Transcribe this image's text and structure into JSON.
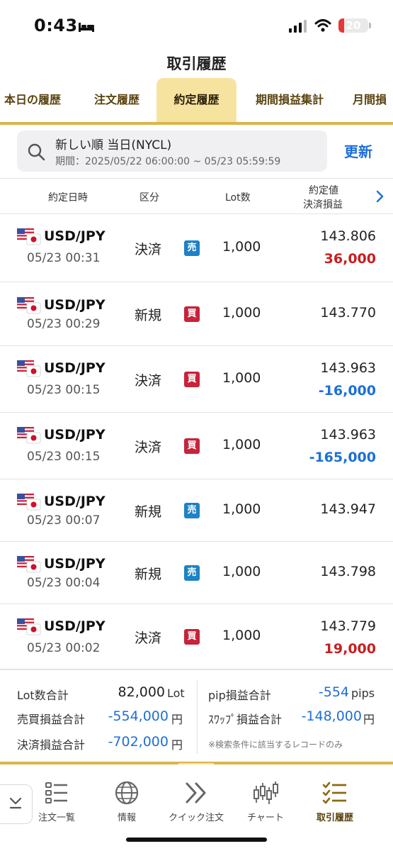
{
  "status_bar": {
    "time": "0:43",
    "battery": "20",
    "battery_level": 0.2
  },
  "header": {
    "title": "取引履歴"
  },
  "tabs": [
    {
      "label": "本日の履歴",
      "active": false
    },
    {
      "label": "注文履歴",
      "active": false
    },
    {
      "label": "約定履歴",
      "active": true
    },
    {
      "label": "期間損益集計",
      "active": false
    },
    {
      "label": "月間損",
      "active": false
    }
  ],
  "search": {
    "main": "新しい順 当日(NYCL)",
    "period": "期間：2025/05/22 06:00:00 ~ 05/23 05:59:59",
    "refresh_label": "更新"
  },
  "columns": {
    "datetime": "約定日時",
    "kind": "区分",
    "lot": "Lot数",
    "price": "約定値",
    "pnl": "決済損益"
  },
  "side_labels": {
    "sell": "売",
    "buy": "買"
  },
  "rows": [
    {
      "pair": "USD/JPY",
      "datetime": "05/23 00:31",
      "kind": "決済",
      "side": "sell",
      "side_label": "売",
      "lot": "1,000",
      "price": "143.806",
      "pnl": "36,000",
      "pnl_sign": "pos"
    },
    {
      "pair": "USD/JPY",
      "datetime": "05/23 00:29",
      "kind": "新規",
      "side": "buy",
      "side_label": "買",
      "lot": "1,000",
      "price": "143.770",
      "pnl": "",
      "pnl_sign": ""
    },
    {
      "pair": "USD/JPY",
      "datetime": "05/23 00:15",
      "kind": "決済",
      "side": "buy",
      "side_label": "買",
      "lot": "1,000",
      "price": "143.963",
      "pnl": "-16,000",
      "pnl_sign": "neg"
    },
    {
      "pair": "USD/JPY",
      "datetime": "05/23 00:15",
      "kind": "決済",
      "side": "buy",
      "side_label": "買",
      "lot": "1,000",
      "price": "143.963",
      "pnl": "-165,000",
      "pnl_sign": "neg"
    },
    {
      "pair": "USD/JPY",
      "datetime": "05/23 00:07",
      "kind": "新規",
      "side": "sell",
      "side_label": "売",
      "lot": "1,000",
      "price": "143.947",
      "pnl": "",
      "pnl_sign": ""
    },
    {
      "pair": "USD/JPY",
      "datetime": "05/23 00:04",
      "kind": "新規",
      "side": "sell",
      "side_label": "売",
      "lot": "1,000",
      "price": "143.798",
      "pnl": "",
      "pnl_sign": ""
    },
    {
      "pair": "USD/JPY",
      "datetime": "05/23 00:02",
      "kind": "決済",
      "side": "buy",
      "side_label": "買",
      "lot": "1,000",
      "price": "143.779",
      "pnl": "19,000",
      "pnl_sign": "pos"
    }
  ],
  "summary": {
    "lot_total_label": "Lot数合計",
    "lot_total_value": "82,000",
    "lot_total_unit": "Lot",
    "trade_pnl_label": "売買損益合計",
    "trade_pnl_value": "-554,000",
    "trade_pnl_unit": "円",
    "settle_pnl_label": "決済損益合計",
    "settle_pnl_value": "-702,000",
    "settle_pnl_unit": "円",
    "pip_pnl_label": "pip損益合計",
    "pip_pnl_value": "-554",
    "pip_pnl_unit": "pips",
    "swap_pnl_label": "ｽﾜｯﾌﾟ損益合計",
    "swap_pnl_value": "-148,000",
    "swap_pnl_unit": "円",
    "note": "※検索条件に該当するレコードのみ"
  },
  "bottom_nav": [
    {
      "label": "注文一覧",
      "icon": "list-icon",
      "active": false
    },
    {
      "label": "情報",
      "icon": "globe-icon",
      "active": false
    },
    {
      "label": "クイック注文",
      "icon": "double-chevron-icon",
      "active": false
    },
    {
      "label": "チャート",
      "icon": "candlestick-icon",
      "active": false
    },
    {
      "label": "取引履歴",
      "icon": "checklist-icon",
      "active": true
    }
  ],
  "colors": {
    "accent_gold": "#d9b64a",
    "active_tab_bg": "#f7e3a0",
    "positive": "#c81e1e",
    "negative": "#1d6fd6",
    "sell": "#1d82c6",
    "buy": "#c8233a"
  }
}
